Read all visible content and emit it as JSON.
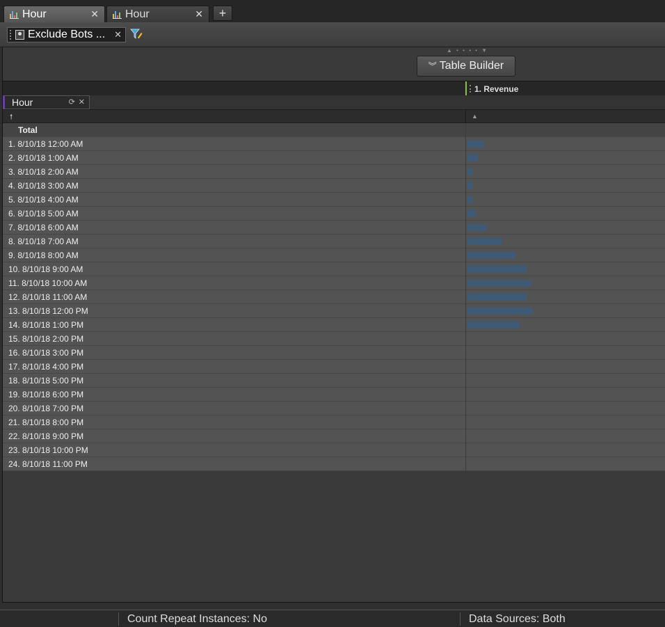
{
  "tabs": [
    {
      "label": "Hour",
      "active": true
    },
    {
      "label": "Hour",
      "active": false
    }
  ],
  "add_tab_label": "+",
  "segment": {
    "label": "Exclude Bots ..."
  },
  "table_builder": {
    "label": "Table Builder"
  },
  "metric_header": "1. Revenue",
  "dimension_header": "Hour",
  "total_label": "Total",
  "rows": [
    {
      "label": "1.  8/10/18 12:00 AM",
      "revenue": 0.26
    },
    {
      "label": "2.  8/10/18 1:00 AM",
      "revenue": 0.16
    },
    {
      "label": "3.  8/10/18 2:00 AM",
      "revenue": 0.09
    },
    {
      "label": "4.  8/10/18 3:00 AM",
      "revenue": 0.08
    },
    {
      "label": "5.  8/10/18 4:00 AM",
      "revenue": 0.08
    },
    {
      "label": "6.  8/10/18 5:00 AM",
      "revenue": 0.13
    },
    {
      "label": "7.  8/10/18 6:00 AM",
      "revenue": 0.3
    },
    {
      "label": "8.  8/10/18 7:00 AM",
      "revenue": 0.52
    },
    {
      "label": "9.  8/10/18 8:00 AM",
      "revenue": 0.73
    },
    {
      "label": "10.  8/10/18 9:00 AM",
      "revenue": 0.9
    },
    {
      "label": "11.  8/10/18 10:00 AM",
      "revenue": 0.98
    },
    {
      "label": "12.  8/10/18 11:00 AM",
      "revenue": 0.9
    },
    {
      "label": "13.  8/10/18 12:00 PM",
      "revenue": 1.0
    },
    {
      "label": "14.  8/10/18 1:00 PM",
      "revenue": 0.8
    },
    {
      "label": "15.  8/10/18 2:00 PM",
      "revenue": 0
    },
    {
      "label": "16.  8/10/18 3:00 PM",
      "revenue": 0
    },
    {
      "label": "17.  8/10/18 4:00 PM",
      "revenue": 0
    },
    {
      "label": "18.  8/10/18 5:00 PM",
      "revenue": 0
    },
    {
      "label": "19.  8/10/18 6:00 PM",
      "revenue": 0
    },
    {
      "label": "20.  8/10/18 7:00 PM",
      "revenue": 0
    },
    {
      "label": "21.  8/10/18 8:00 PM",
      "revenue": 0
    },
    {
      "label": "22.  8/10/18 9:00 PM",
      "revenue": 0
    },
    {
      "label": "23.  8/10/18 10:00 PM",
      "revenue": 0
    },
    {
      "label": "24.  8/10/18 11:00 PM",
      "revenue": 0
    }
  ],
  "status": {
    "count_repeat": "Count Repeat Instances:  No",
    "data_sources": "Data Sources:  Both"
  },
  "colors": {
    "bar": "#3e5a75",
    "active_tab": "#5f5f5f",
    "metric_accent": "#8fbf3f",
    "dimension_accent": "#6a3fa0"
  },
  "icons": [
    "chart-icon",
    "close-icon",
    "add-icon",
    "segment-person-icon",
    "filter-icon",
    "chevron-double-down-icon",
    "refresh-icon",
    "sort-arrow-icon"
  ]
}
